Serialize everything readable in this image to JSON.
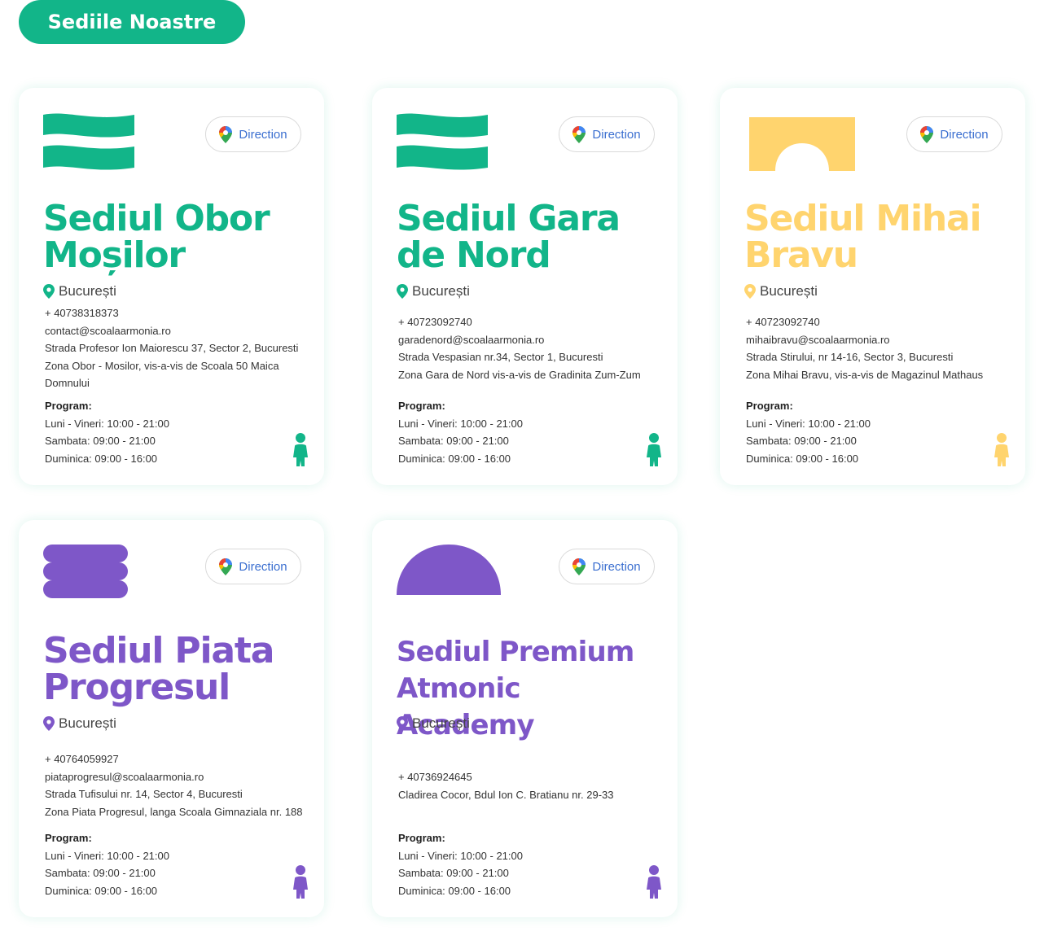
{
  "header": {
    "title": "Sediile Noastre"
  },
  "labels": {
    "direction": "Direction",
    "program": "Program:"
  },
  "colors": {
    "green": "#12b589",
    "yellow": "#ffd46e",
    "purple": "#7e57c8",
    "link_blue": "#3b6fd0"
  },
  "locations": [
    {
      "name": "Sediul Obor Moșilor",
      "city": "București",
      "phone": "+ 40738318373",
      "email": "contact@scoalaarmonia.ro",
      "address": "Strada Profesor Ion Maiorescu 37, Sector 2, Bucuresti",
      "zone": "Zona Obor - Mosilor, vis-a-vis de Scoala 50 Maica Domnului",
      "hours": [
        "Luni - Vineri: 10:00 - 21:00",
        "Sambata: 09:00 - 21:00",
        "Duminica: 09:00 - 16:00"
      ]
    },
    {
      "name": "Sediul Gara de Nord",
      "city": "București",
      "phone": "+ 40723092740",
      "email": "garadenord@scoalaarmonia.ro",
      "address": "Strada Vespasian nr.34, Sector 1, Bucuresti",
      "zone": "Zona Gara de Nord vis-a-vis de Gradinita Zum-Zum",
      "hours": [
        "Luni - Vineri: 10:00 - 21:00",
        "Sambata: 09:00 - 21:00",
        "Duminica: 09:00 - 16:00"
      ]
    },
    {
      "name": "Sediul Mihai Bravu",
      "city": "București",
      "phone": "+ 40723092740",
      "email": "mihaibravu@scoalaarmonia.ro",
      "address": "Strada Stirului, nr 14-16, Sector 3, Bucuresti",
      "zone": "Zona Mihai Bravu, vis-a-vis de Magazinul Mathaus",
      "hours": [
        "Luni - Vineri: 10:00 - 21:00",
        "Sambata: 09:00 - 21:00",
        "Duminica: 09:00 - 16:00"
      ]
    },
    {
      "name": "Sediul Piata Progresul",
      "city": "București",
      "phone": "+ 40764059927",
      "email": "piataprogresul@scoalaarmonia.ro",
      "address": "Strada Tufisului nr. 14, Sector 4, Bucuresti",
      "zone": "Zona Piata Progresul, langa Scoala Gimnaziala nr. 188",
      "hours": [
        "Luni - Vineri: 10:00 - 21:00",
        "Sambata: 09:00 - 21:00",
        "Duminica: 09:00 - 16:00"
      ]
    },
    {
      "name": "Sediul Premium Atmonic Academy",
      "city": "București",
      "phone": "+ 40736924645",
      "address": "Cladirea Cocor, Bdul Ion C. Bratianu nr. 29-33",
      "hours": [
        "Luni - Vineri: 10:00 - 21:00",
        "Sambata: 09:00 - 21:00",
        "Duminica: 09:00 - 16:00"
      ]
    }
  ]
}
